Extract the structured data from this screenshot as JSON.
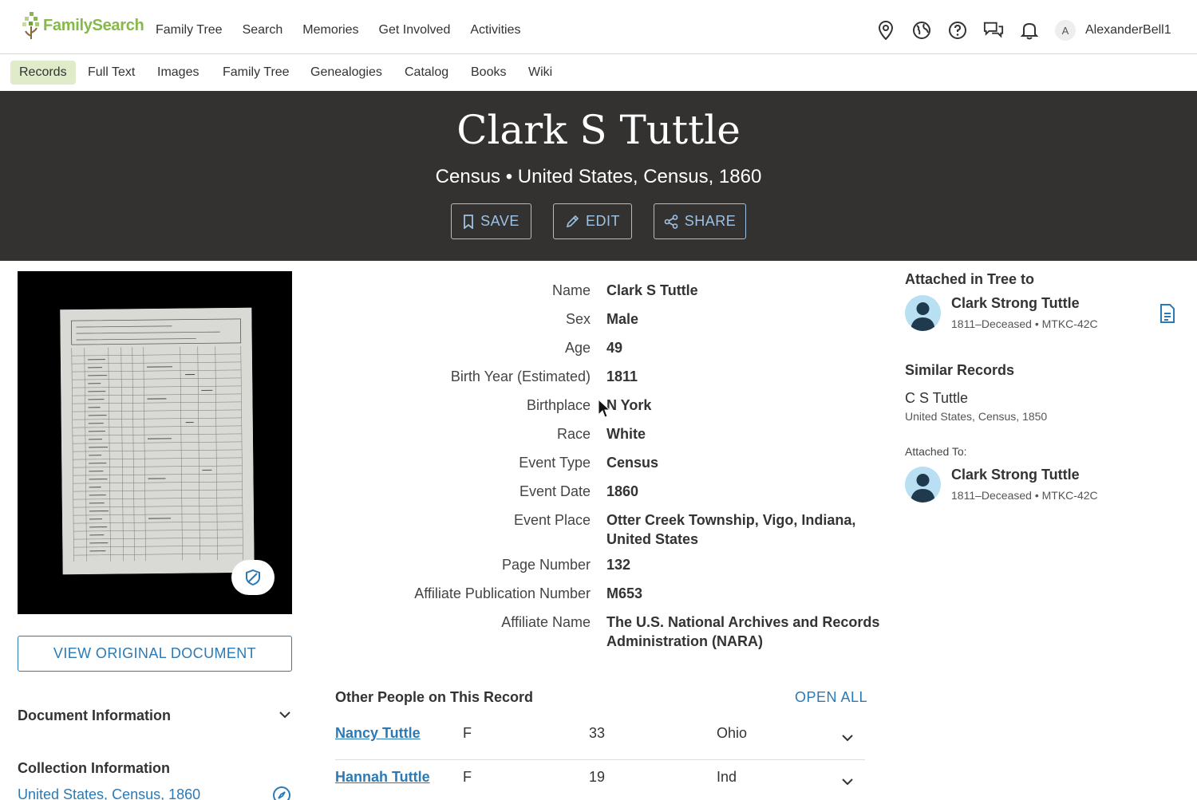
{
  "brand": {
    "logo_text": "FamilySearch",
    "accent": "#87b84a",
    "link_color": "#2b7ab5"
  },
  "top_nav": {
    "links": [
      "Family Tree",
      "Search",
      "Memories",
      "Get Involved",
      "Activities"
    ],
    "avatar_initial": "A",
    "username": "AlexanderBell1"
  },
  "sub_nav": {
    "items": [
      "Records",
      "Full Text",
      "Images",
      "Family Tree",
      "Genealogies",
      "Catalog",
      "Books",
      "Wiki"
    ],
    "active": "Records"
  },
  "hero": {
    "title": "Clark S Tuttle",
    "subtitle": "Census • United States, Census, 1860",
    "save_label": "SAVE",
    "edit_label": "EDIT",
    "share_label": "SHARE"
  },
  "left": {
    "view_document_label": "VIEW ORIGINAL DOCUMENT",
    "document_information": "Document Information",
    "collection_information": "Collection Information",
    "collection_link": "United States, Census, 1860"
  },
  "fields": [
    {
      "label": "Name",
      "value": "Clark S Tuttle"
    },
    {
      "label": "Sex",
      "value": "Male"
    },
    {
      "label": "Age",
      "value": "49"
    },
    {
      "label": "Birth Year (Estimated)",
      "value": "1811"
    },
    {
      "label": "Birthplace",
      "value": "N York"
    },
    {
      "label": "Race",
      "value": "White"
    },
    {
      "label": "Event Type",
      "value": "Census"
    },
    {
      "label": "Event Date",
      "value": "1860"
    },
    {
      "label": "Event Place",
      "value": "Otter Creek Township, Vigo, Indiana, United States"
    },
    {
      "label": "Page Number",
      "value": "132"
    },
    {
      "label": "Affiliate Publication Number",
      "value": "M653"
    },
    {
      "label": "Affiliate Name",
      "value": "The U.S. National Archives and Records Administration (NARA)"
    }
  ],
  "other_people": {
    "title": "Other People on This Record",
    "open_all": "OPEN ALL",
    "rows": [
      {
        "name": "Nancy Tuttle",
        "sex": "F",
        "age": "33",
        "place": "Ohio"
      },
      {
        "name": "Hannah Tuttle",
        "sex": "F",
        "age": "19",
        "place": "Ind"
      }
    ]
  },
  "right": {
    "attached_title": "Attached in Tree to",
    "attached_person": {
      "name": "Clark Strong Tuttle",
      "meta": "1811–Deceased • MTKC-42C"
    },
    "similar_title": "Similar Records",
    "similar": {
      "name": "C S Tuttle",
      "meta": "United States, Census, 1850"
    },
    "attached_to_label": "Attached To:",
    "attached_to_person": {
      "name": "Clark Strong Tuttle",
      "meta": "1811–Deceased • MTKC-42C"
    }
  }
}
